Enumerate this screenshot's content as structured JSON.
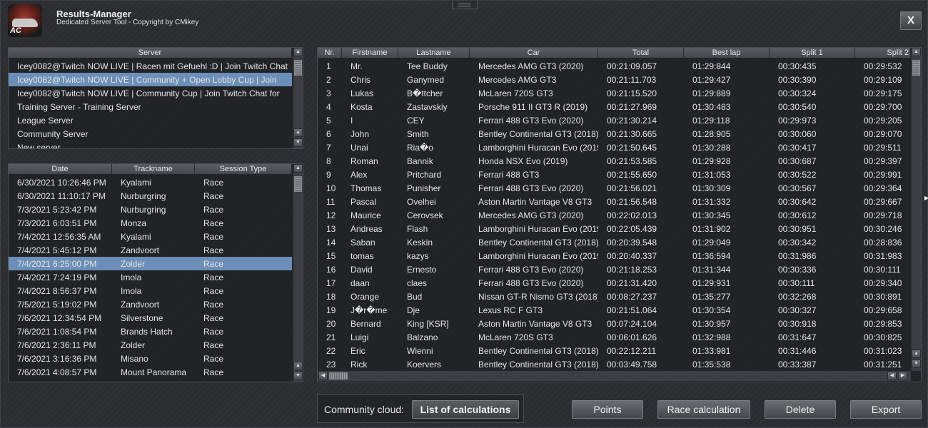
{
  "app": {
    "title": "Results-Manager",
    "subtitle": "Dedicated Server Tool - Copyright by CMikey",
    "logo_text": "AC",
    "close_label": "X"
  },
  "server_panel": {
    "header": "Server",
    "items": [
      "Icey0082@Twitch NOW LIVE | Racen mit Gefuehl :D | Join Twitch Chat",
      "Icey0082@Twitch NOW LIVE | Community + Open Lobby Cup | Join",
      "Icey0082@Twitch NOW LIVE | Community Cup | Join Twitch Chat for",
      "Training Server - Training Server",
      "League Server",
      "Community Server",
      "New server"
    ],
    "selected_index": 1
  },
  "sessions_panel": {
    "headers": [
      "Date",
      "Trackname",
      "Session Type"
    ],
    "rows": [
      [
        "6/30/2021 10:26:46 PM",
        "Kyalami",
        "Race"
      ],
      [
        "6/30/2021 11:10:17 PM",
        "Nurburgring",
        "Race"
      ],
      [
        "7/3/2021 5:23:42 PM",
        "Nurburgring",
        "Race"
      ],
      [
        "7/3/2021 6:03:51 PM",
        "Monza",
        "Race"
      ],
      [
        "7/4/2021 12:56:35 AM",
        "Kyalami",
        "Race"
      ],
      [
        "7/4/2021 5:45:12 PM",
        "Zandvoort",
        "Race"
      ],
      [
        "7/4/2021 6:25:00 PM",
        "Zolder",
        "Race"
      ],
      [
        "7/4/2021 7:24:19 PM",
        "Imola",
        "Race"
      ],
      [
        "7/4/2021 8:56:37 PM",
        "Imola",
        "Race"
      ],
      [
        "7/5/2021 5:19:02 PM",
        "Zandvoort",
        "Race"
      ],
      [
        "7/6/2021 12:34:54 PM",
        "Silverstone",
        "Race"
      ],
      [
        "7/6/2021 1:08:54 PM",
        "Brands Hatch",
        "Race"
      ],
      [
        "7/6/2021 2:36:11 PM",
        "Zolder",
        "Race"
      ],
      [
        "7/6/2021 3:16:36 PM",
        "Misano",
        "Race"
      ],
      [
        "7/6/2021 4:08:57 PM",
        "Mount Panorama",
        "Race"
      ]
    ],
    "selected_index": 6
  },
  "results_panel": {
    "headers": [
      "Nr.",
      "Firstname",
      "Lastname",
      "Car",
      "Total",
      "Best lap",
      "Split 1",
      "Split 2"
    ],
    "rows": [
      [
        "1",
        "Mr.",
        "Tee Buddy",
        "Mercedes AMG GT3 (2020)",
        "00:21:09.057",
        "01:29:844",
        "00:30:435",
        "00:29:532"
      ],
      [
        "2",
        "Chris",
        "Ganymed",
        "Mercedes AMG GT3",
        "00:21:11.703",
        "01:29:427",
        "00:30:390",
        "00:29:109"
      ],
      [
        "3",
        "Lukas",
        "B�ttcher",
        "McLaren 720S GT3",
        "00:21:15.520",
        "01:29:889",
        "00:30:324",
        "00:29:175"
      ],
      [
        "4",
        "Kosta",
        "Zastavskiy",
        "Porsche 911 II GT3 R (2019)",
        "00:21:27.969",
        "01:30:483",
        "00:30:540",
        "00:29:700"
      ],
      [
        "5",
        "I",
        "CEY",
        "Ferrari 488 GT3 Evo (2020)",
        "00:21:30.214",
        "01:29:118",
        "00:29:973",
        "00:29:205"
      ],
      [
        "6",
        "John",
        "Smith",
        "Bentley Continental GT3 (2018)",
        "00:21:30.665",
        "01:28:905",
        "00:30:060",
        "00:29:070"
      ],
      [
        "7",
        "Unai",
        "Ria�o",
        "Lamborghini Huracan Evo (2019",
        "00:21:50.645",
        "01:30:288",
        "00:30:417",
        "00:29:511"
      ],
      [
        "8",
        "Roman",
        "Bannik",
        "Honda NSX Evo (2019)",
        "00:21:53.585",
        "01:29:928",
        "00:30:687",
        "00:29:397"
      ],
      [
        "9",
        "Alex",
        "Pritchard",
        "Ferrari 488 GT3",
        "00:21:55.650",
        "01:31:053",
        "00:30:522",
        "00:29:991"
      ],
      [
        "10",
        "Thomas",
        "Punisher",
        "Ferrari 488 GT3 Evo (2020)",
        "00:21:56.021",
        "01:30:309",
        "00:30:567",
        "00:29:364"
      ],
      [
        "11",
        "Pascal",
        "Ovelhei",
        "Aston Martin Vantage V8 GT3",
        "00:21:56.548",
        "01:31:332",
        "00:30:642",
        "00:29:667"
      ],
      [
        "12",
        "Maurice",
        "Cerovsek",
        "Mercedes AMG GT3 (2020)",
        "00:22:02.013",
        "01:30:345",
        "00:30:612",
        "00:29:718"
      ],
      [
        "13",
        "Andreas",
        "Flash",
        "Lamborghini Huracan Evo (2019",
        "00:22:05.439",
        "01:31:902",
        "00:30:951",
        "00:30:246"
      ],
      [
        "14",
        "Saban",
        "Keskin",
        "Bentley Continental GT3 (2018)",
        "00:20:39.548",
        "01:29:049",
        "00:30:342",
        "00:28:836"
      ],
      [
        "15",
        "tomas",
        "kazys",
        "Lamborghini Huracan Evo (2019",
        "00:20:40.337",
        "01:36:594",
        "00:31:986",
        "00:31:983"
      ],
      [
        "16",
        "David",
        "Ernesto",
        "Ferrari 488 GT3 Evo (2020)",
        "00:21:18.253",
        "01:31:344",
        "00:30:336",
        "00:30:111"
      ],
      [
        "17",
        "daan",
        "claes",
        "Ferrari 488 GT3 Evo (2020)",
        "00:21:31.420",
        "01:29:931",
        "00:30:111",
        "00:29:340"
      ],
      [
        "18",
        "Orange",
        "Bud",
        "Nissan GT-R Nismo GT3 (2018)",
        "00:08:27.237",
        "01:35:277",
        "00:32:268",
        "00:30:891"
      ],
      [
        "19",
        "J�r�me",
        "Dje",
        "Lexus RC F GT3",
        "00:21:51.064",
        "01:30:354",
        "00:30:327",
        "00:29:658"
      ],
      [
        "20",
        "Bernard",
        "King [KSR]",
        "Aston Martin Vantage V8 GT3",
        "00:07:24.104",
        "01:30:957",
        "00:30:918",
        "00:29:853"
      ],
      [
        "21",
        "Luigi",
        "Balzano",
        "McLaren 720S GT3",
        "00:06:01.626",
        "01:32:988",
        "00:31:647",
        "00:30:825"
      ],
      [
        "22",
        "Eric",
        "Wienni",
        "Bentley Continental GT3 (2018)",
        "00:22:12.211",
        "01:33:981",
        "00:31:446",
        "00:31:023"
      ],
      [
        "23",
        "Rick",
        "Koervers",
        "Bentley Continental GT3 (2018)",
        "00:03:49.758",
        "01:35:538",
        "00:33:387",
        "00:31:251"
      ]
    ]
  },
  "footer": {
    "community_label": "Community cloud:",
    "list_button": "List of calculations",
    "points_button": "Points",
    "race_calc_button": "Race calculation",
    "delete_button": "Delete",
    "export_button": "Export"
  }
}
